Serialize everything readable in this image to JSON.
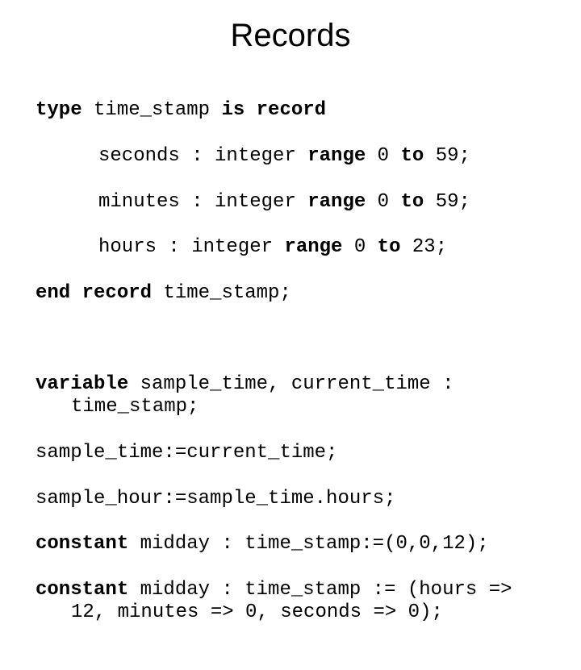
{
  "title": "Records",
  "code": {
    "l1_a": "type",
    "l1_b": " time_stamp ",
    "l1_c": "is record",
    "l2_a": "seconds : integer ",
    "l2_b": "range",
    "l2_c": " 0 ",
    "l2_d": "to",
    "l2_e": " 59;",
    "l3_a": "minutes : integer ",
    "l3_b": "range",
    "l3_c": " 0 ",
    "l3_d": "to",
    "l3_e": " 59;",
    "l4_a": "hours : integer ",
    "l4_b": "range",
    "l4_c": " 0 ",
    "l4_d": "to",
    "l4_e": " 23;",
    "l5_a": "end record",
    "l5_b": " time_stamp;",
    "blank": " ",
    "l6_a": "variable",
    "l6_b": " sample_time, current_time : time_stamp;",
    "l7": "sample_time:=current_time;",
    "l8": "sample_hour:=sample_time.hours;",
    "l9_a": "constant",
    "l9_b": " midday : time_stamp:=(0,0,12);",
    "l10_a": "constant",
    "l10_b": " midday : time_stamp := (hours => 12, minutes => 0, seconds => 0);"
  }
}
